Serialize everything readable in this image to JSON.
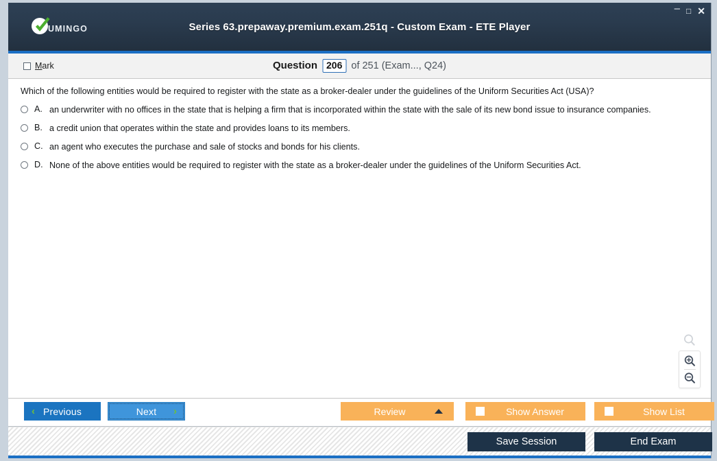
{
  "window": {
    "title": "Series 63.prepaway.premium.exam.251q - Custom Exam - ETE Player",
    "logo_text": "UMINGO",
    "logo_icon": "vumingo-check-logo",
    "controls": {
      "minimize": "–",
      "maximize": "□",
      "close": "✕"
    },
    "accent_color": "#1b6fc4",
    "titlebar_color": "#2a3b4e"
  },
  "question_header": {
    "mark_label_pre": "",
    "mark_label_accel": "M",
    "mark_label_rest": "ark",
    "mark_checked": false,
    "question_word": "Question",
    "question_number": "206",
    "of_text": "of 251 (Exam..., Q24)"
  },
  "question": {
    "text": "Which of the following entities would be required to register with the state as a broker-dealer under the guidelines of the Uniform Securities Act (USA)?",
    "selected": null,
    "options": [
      {
        "letter": "A.",
        "text": "an underwriter with no offices in the state that is helping a firm that is incorporated within the state with the sale of its new bond issue to insurance companies."
      },
      {
        "letter": "B.",
        "text": "a credit union that operates within the state and provides loans to its members."
      },
      {
        "letter": "C.",
        "text": "an agent who executes the purchase and sale of stocks and bonds for his clients."
      },
      {
        "letter": "D.",
        "text": "None of the above entities would be required to register with the state as a broker-dealer under the guidelines of the Uniform Securities Act."
      }
    ]
  },
  "zoom_tools": {
    "search_icon": "magnifier-icon",
    "zoom_in_icon": "zoom-in-icon",
    "zoom_out_icon": "zoom-out-icon"
  },
  "toolbar": {
    "previous_label": "Previous",
    "next_label": "Next",
    "review_label": "Review",
    "show_answer_label": "Show Answer",
    "show_list_label": "Show List",
    "prev_chevron": "‹",
    "next_chevron": "›",
    "review_arrow": "caret-up-icon",
    "orange_color": "#f9b259",
    "next_focused": true
  },
  "statusbar": {
    "save_session_label": "Save Session",
    "end_exam_label": "End Exam"
  }
}
